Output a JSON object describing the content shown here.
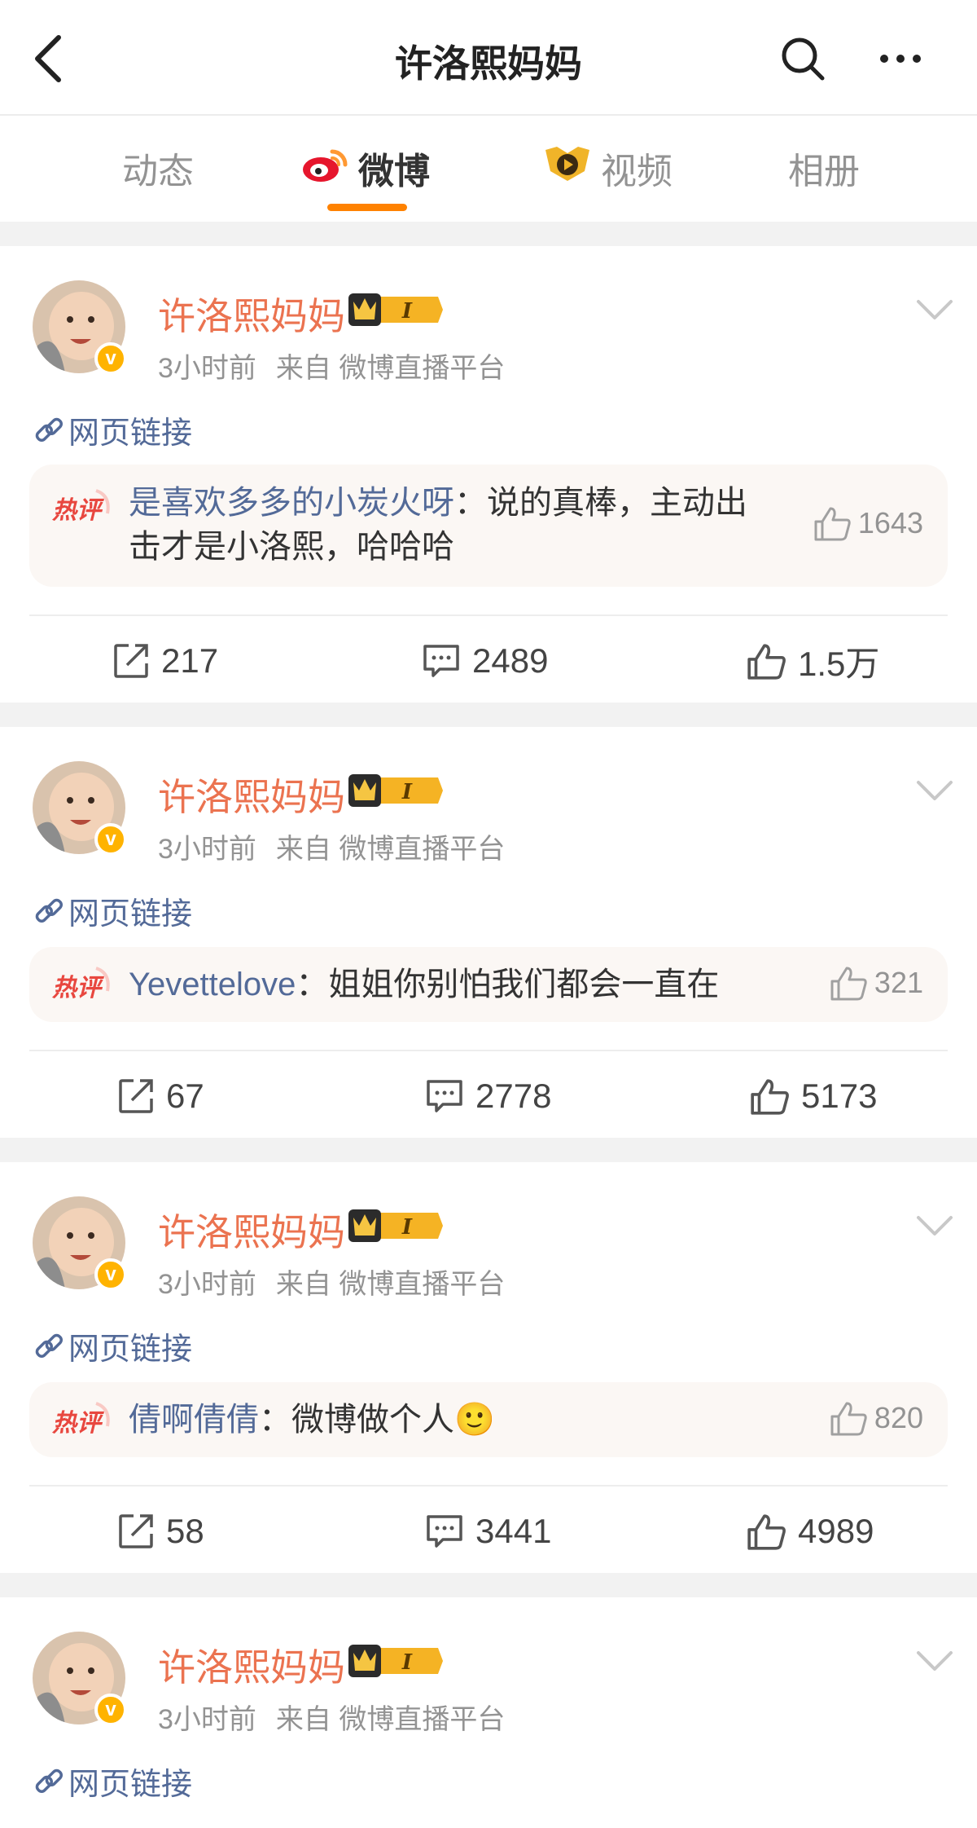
{
  "header": {
    "title": "许洛熙妈妈",
    "back_icon": "chevron-left-icon",
    "search_icon": "search-icon",
    "more_icon": "more-icon"
  },
  "tabs": [
    {
      "label": "动态",
      "icon": null
    },
    {
      "label": "微博",
      "icon": "weibo-logo-icon",
      "active": true
    },
    {
      "label": "视频",
      "icon": "video-icon"
    },
    {
      "label": "相册",
      "icon": null
    }
  ],
  "colors": {
    "accent": "#ff8200",
    "username": "#eb7350",
    "link": "#536a98",
    "hot_bg": "#fbf7f4",
    "hot_label": "#e8473f"
  },
  "posts": [
    {
      "user": "许洛熙妈妈",
      "time": "3小时前",
      "source": "来自 微博直播平台",
      "link_text": "网页链接",
      "hot_label": "热评",
      "hot_user": "是喜欢多多的小炭火呀",
      "hot_sep": "：",
      "hot_text_line1": "说的真棒，主动出",
      "hot_text_line2": "击才是小洛熙，哈哈哈",
      "hot_likes": "1643",
      "reposts": "217",
      "comments": "2489",
      "likes": "1.5万"
    },
    {
      "user": "许洛熙妈妈",
      "time": "3小时前",
      "source": "来自 微博直播平台",
      "link_text": "网页链接",
      "hot_label": "热评",
      "hot_user": "Yevettelove",
      "hot_sep": "：",
      "hot_text_line1": "姐姐你别怕我们都会一直在",
      "hot_likes": "321",
      "reposts": "67",
      "comments": "2778",
      "likes": "5173"
    },
    {
      "user": "许洛熙妈妈",
      "time": "3小时前",
      "source": "来自 微博直播平台",
      "link_text": "网页链接",
      "hot_label": "热评",
      "hot_user": "倩啊倩倩",
      "hot_sep": "：",
      "hot_text_line1": "微博做个人",
      "hot_emoji": "🙂",
      "hot_likes": "820",
      "reposts": "58",
      "comments": "3441",
      "likes": "4989"
    },
    {
      "user": "许洛熙妈妈",
      "time": "3小时前",
      "source": "来自 微博直播平台",
      "link_text": "网页链接"
    }
  ]
}
